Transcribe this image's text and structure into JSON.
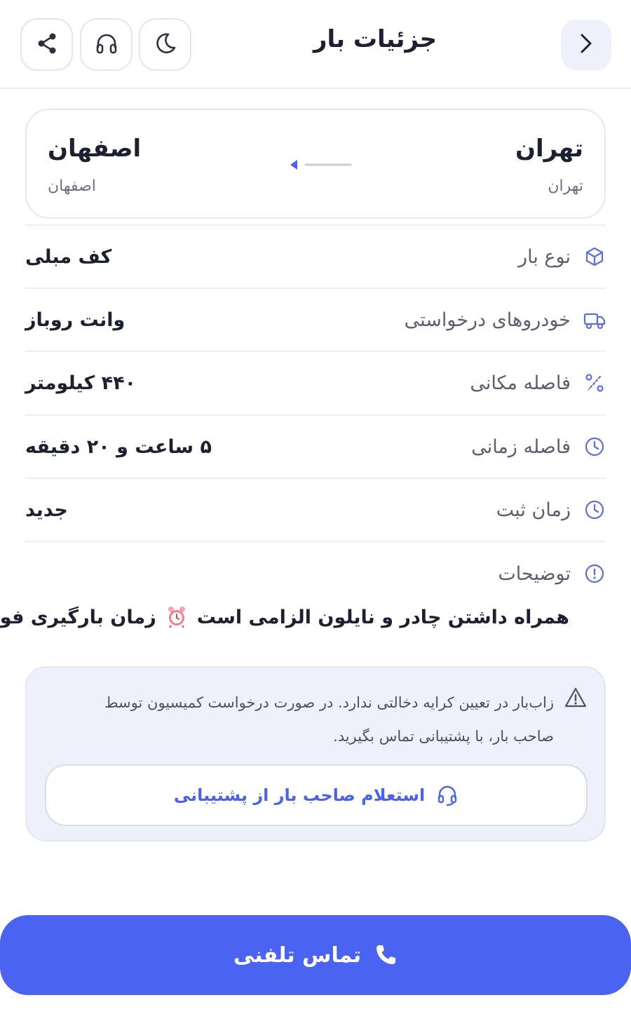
{
  "header": {
    "title": "جزئیات بار"
  },
  "route": {
    "origin": {
      "city": "تهران",
      "province": "تهران"
    },
    "destination": {
      "city": "اصفهان",
      "province": "اصفهان"
    }
  },
  "details": [
    {
      "icon": "box-icon",
      "label": "نوع بار",
      "value": "کف مبلی"
    },
    {
      "icon": "truck-icon",
      "label": "خودروهای درخواستی",
      "value": "وانت روباز"
    },
    {
      "icon": "route-icon",
      "label": "فاصله مکانی",
      "value": "۴۴۰ کیلومتر"
    },
    {
      "icon": "clock-icon",
      "label": "فاصله زمانی",
      "value": "۵ ساعت و ۲۰ دقیقه"
    },
    {
      "icon": "clock-icon",
      "label": "زمان ثبت",
      "value": "جدید"
    }
  ],
  "description": {
    "label": "توضیحات",
    "text_part1": "همراه داشتن چادر و نایلون الزامی است",
    "emoji": "alarm-clock-icon",
    "text_part2": "زمان بارگیری فوری"
  },
  "notice": {
    "text": "زاب‌بار در تعیین کرایه دخالتی ندارد. در صورت درخواست کمیسیون توسط صاحب بار، با پشتیبانی تماس بگیرید.",
    "button_label": "استعلام صاحب بار از پشتیبانی"
  },
  "call_button": {
    "label": "تماس تلفنی"
  },
  "colors": {
    "primary": "#4a63f1",
    "accent_text": "#4a63e7",
    "notice_bg": "#eef1fb",
    "icon_blue": "#5b6fd6"
  }
}
